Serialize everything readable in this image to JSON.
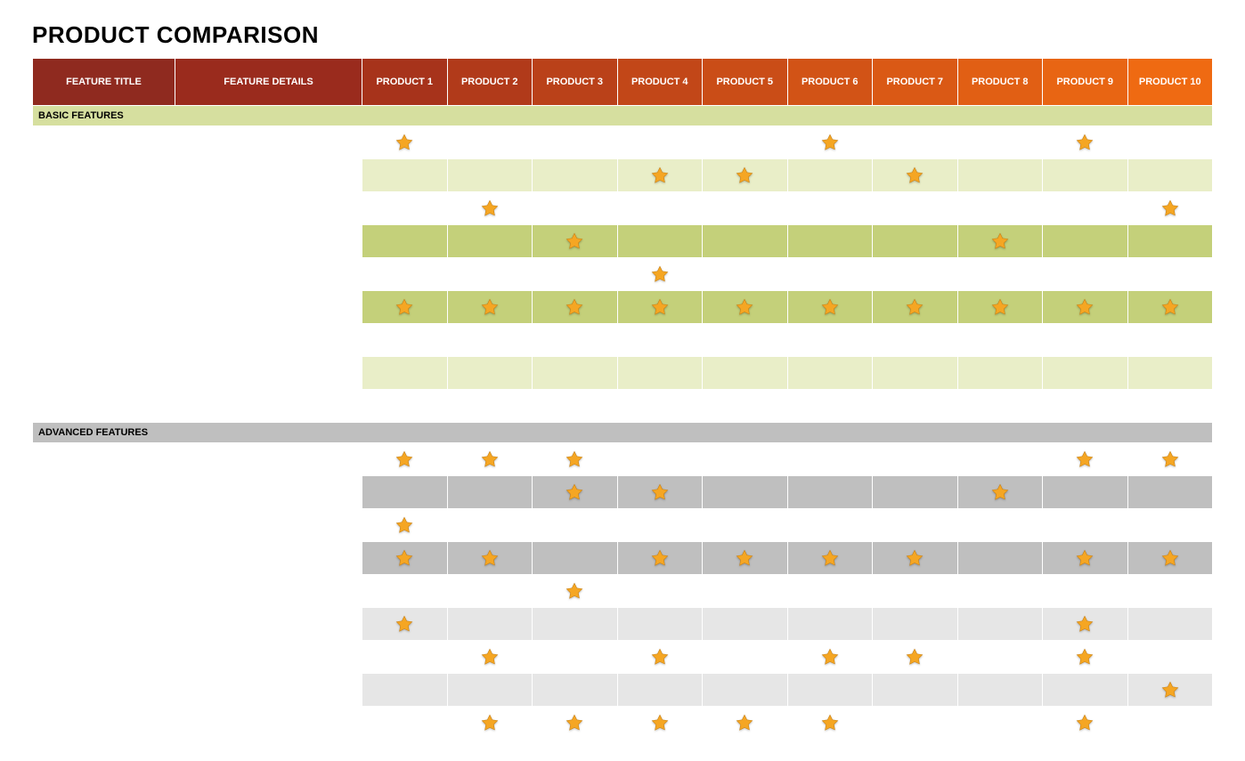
{
  "title": "PRODUCT COMPARISON",
  "columns": {
    "feature_title": "FEATURE TITLE",
    "feature_details": "FEATURE DETAILS",
    "products": [
      "PRODUCT 1",
      "PRODUCT 2",
      "PRODUCT 3",
      "PRODUCT 4",
      "PRODUCT 5",
      "PRODUCT 6",
      "PRODUCT 7",
      "PRODUCT 8",
      "PRODUCT 9",
      "PRODUCT 10"
    ]
  },
  "sections": [
    {
      "label": "BASIC FEATURES",
      "style": "green",
      "rows": [
        {
          "stars": [
            true,
            false,
            false,
            false,
            false,
            true,
            false,
            false,
            true,
            false
          ]
        },
        {
          "stars": [
            false,
            false,
            false,
            true,
            true,
            false,
            true,
            false,
            false,
            false
          ]
        },
        {
          "stars": [
            false,
            true,
            false,
            false,
            false,
            false,
            false,
            false,
            false,
            true
          ]
        },
        {
          "stars": [
            false,
            false,
            true,
            false,
            false,
            false,
            false,
            true,
            false,
            false
          ]
        },
        {
          "stars": [
            false,
            false,
            false,
            true,
            false,
            false,
            false,
            false,
            false,
            false
          ]
        },
        {
          "stars": [
            true,
            true,
            true,
            true,
            true,
            true,
            true,
            true,
            true,
            true
          ]
        },
        {
          "stars": [
            false,
            false,
            false,
            false,
            false,
            false,
            false,
            false,
            false,
            false
          ]
        },
        {
          "stars": [
            false,
            false,
            false,
            false,
            false,
            false,
            false,
            false,
            false,
            false
          ]
        },
        {
          "stars": [
            false,
            false,
            false,
            false,
            false,
            false,
            false,
            false,
            false,
            false
          ]
        }
      ]
    },
    {
      "label": "ADVANCED FEATURES",
      "style": "grey",
      "rows": [
        {
          "stars": [
            true,
            true,
            true,
            false,
            false,
            false,
            false,
            false,
            true,
            true
          ]
        },
        {
          "stars": [
            false,
            false,
            true,
            true,
            false,
            false,
            false,
            true,
            false,
            false
          ]
        },
        {
          "stars": [
            true,
            false,
            false,
            false,
            false,
            false,
            false,
            false,
            false,
            false
          ]
        },
        {
          "stars": [
            true,
            true,
            false,
            true,
            true,
            true,
            true,
            false,
            true,
            true
          ]
        },
        {
          "stars": [
            false,
            false,
            true,
            false,
            false,
            false,
            false,
            false,
            false,
            false
          ]
        },
        {
          "stars": [
            true,
            false,
            false,
            false,
            false,
            false,
            false,
            false,
            true,
            false
          ]
        },
        {
          "stars": [
            false,
            true,
            false,
            true,
            false,
            true,
            true,
            false,
            true,
            false
          ]
        },
        {
          "stars": [
            false,
            false,
            false,
            false,
            false,
            false,
            false,
            false,
            false,
            true
          ]
        },
        {
          "stars": [
            false,
            true,
            true,
            true,
            true,
            true,
            false,
            false,
            true,
            false
          ]
        }
      ]
    }
  ]
}
